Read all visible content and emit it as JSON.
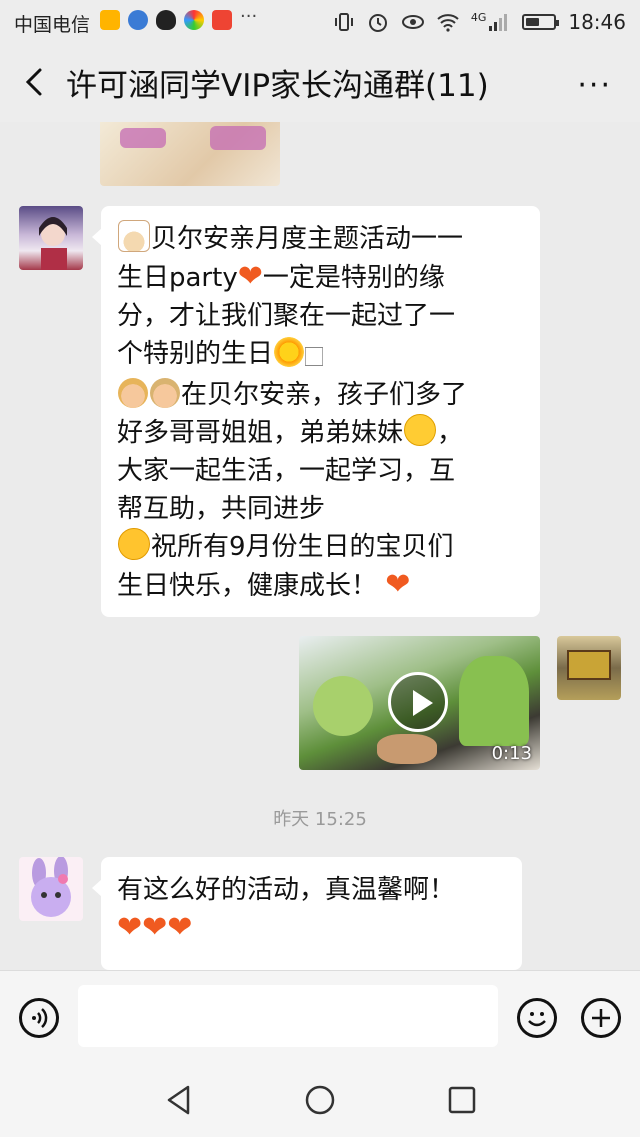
{
  "status_bar": {
    "carrier": "中国电信",
    "icons": [
      "wallet-icon",
      "music-icon",
      "qq-icon",
      "browser-icon",
      "news-icon",
      "more-dots-icon"
    ],
    "right_icons": [
      "vibrate-icon",
      "alarm-icon",
      "eye-icon",
      "4g-icon",
      "signal-icon",
      "battery-icon"
    ],
    "network": "4G",
    "battery_level": 0.5,
    "time": "18:46"
  },
  "header": {
    "title": "许可涵同学VIP家长沟通群(11)",
    "back_icon": "chevron-left-icon",
    "more_icon": "more-horizontal-icon",
    "more_label": "···"
  },
  "messages": [
    {
      "type": "image",
      "sender": "teacher",
      "partial": true
    },
    {
      "type": "text",
      "sender": "teacher",
      "lines": [
        {
          "emoji_before": "cake-emoji",
          "text": "贝尔安亲月度主题活动一一"
        },
        {
          "text": "生日party",
          "emoji_after": "heart-emoji",
          "text2": "一定是特别的缘"
        },
        {
          "text": "分，才让我们聚在一起过了一"
        },
        {
          "text": "个特别的生日",
          "emoji_after": "sun-emoji",
          "tail": "🏻"
        },
        {
          "emoji_before": "kids-emoji",
          "text": "在贝尔安亲，孩子们多了"
        },
        {
          "text": "好多哥哥姐姐，弟弟妹妹",
          "emoji_after": "smile-emoji",
          "text2": "，"
        },
        {
          "text": "大家一起生活，一起学习，互"
        },
        {
          "text": "帮互助，共同进步"
        },
        {
          "emoji_before": "hug-emoji",
          "text": "祝所有9月份生日的宝贝们"
        },
        {
          "text": "生日快乐，健康成长！",
          "emoji_after": "heart-emoji"
        }
      ]
    },
    {
      "type": "video",
      "sender": "self",
      "duration": "0:13"
    },
    {
      "type": "timestamp",
      "text": "昨天 15:25"
    },
    {
      "type": "text",
      "sender": "parent",
      "text": "有这么好的活动，真温馨啊！",
      "hearts": 3
    }
  ],
  "input_bar": {
    "voice_icon": "voice-icon",
    "emoji_icon": "emoji-icon",
    "plus_icon": "plus-icon",
    "placeholder": ""
  },
  "nav_bar": {
    "back": "nav-back-icon",
    "home": "nav-home-icon",
    "recents": "nav-recents-icon"
  },
  "colors": {
    "background": "#ebebeb",
    "bubble": "#ffffff",
    "heart": "#f05a20"
  }
}
